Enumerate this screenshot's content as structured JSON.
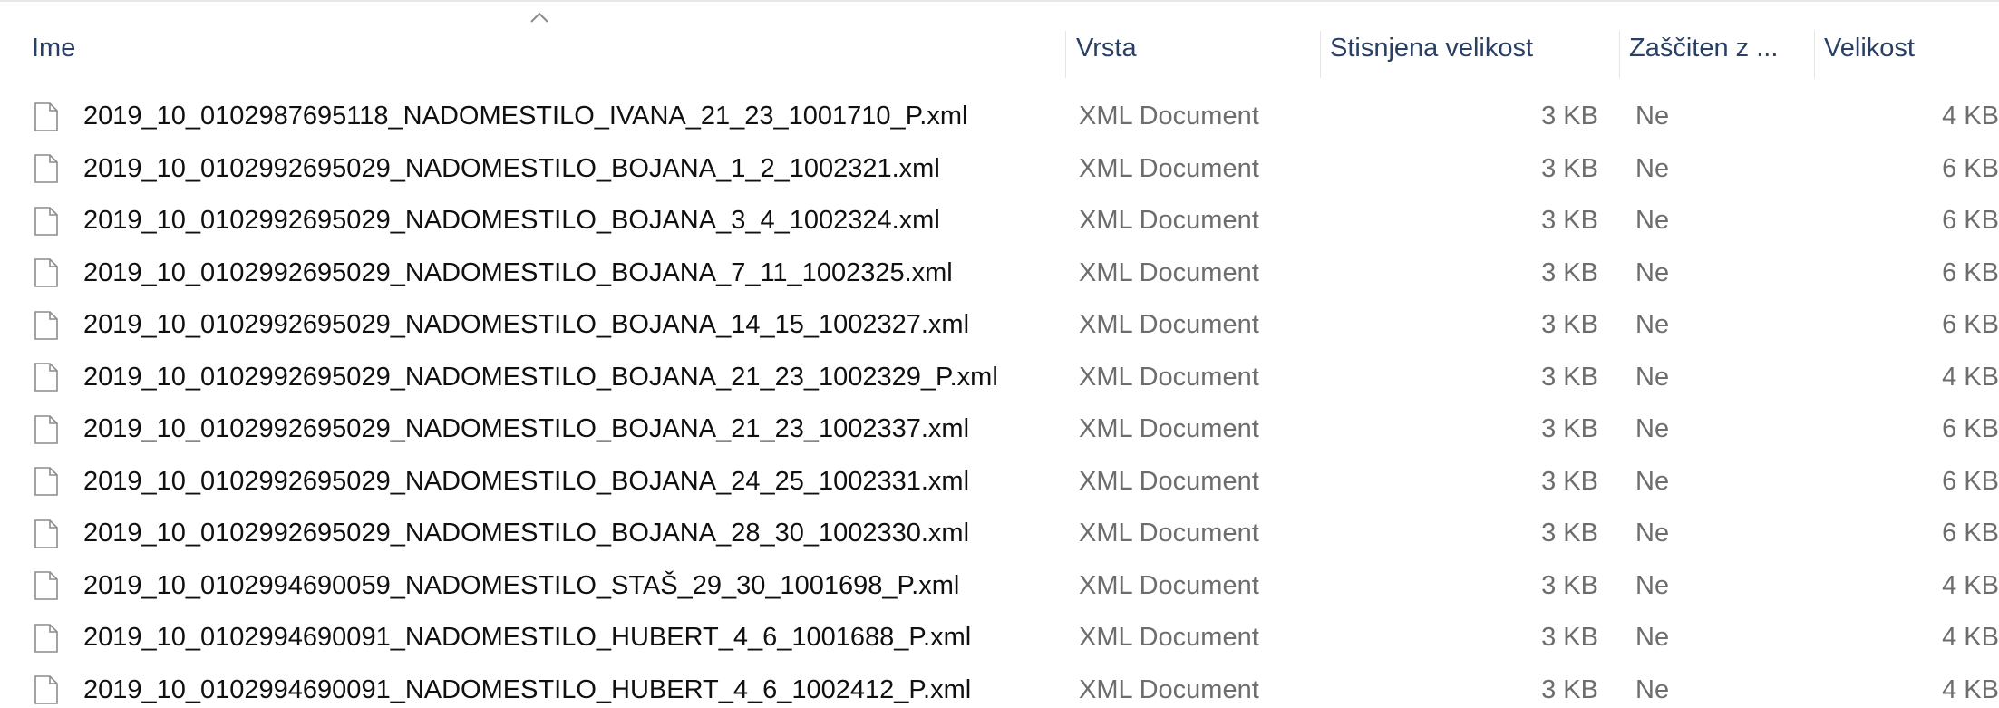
{
  "columns": {
    "name": "Ime",
    "type": "Vrsta",
    "compressed": "Stisnjena velikost",
    "protected": "Zaščiten z ...",
    "size": "Velikost"
  },
  "files": [
    {
      "name": "2019_10_0102987695118_NADOMESTILO_IVANA_21_23_1001710_P.xml",
      "type": "XML Document",
      "compressed": "3 KB",
      "protected": "Ne",
      "size": "4 KB"
    },
    {
      "name": "2019_10_0102992695029_NADOMESTILO_BOJANA_1_2_1002321.xml",
      "type": "XML Document",
      "compressed": "3 KB",
      "protected": "Ne",
      "size": "6 KB"
    },
    {
      "name": "2019_10_0102992695029_NADOMESTILO_BOJANA_3_4_1002324.xml",
      "type": "XML Document",
      "compressed": "3 KB",
      "protected": "Ne",
      "size": "6 KB"
    },
    {
      "name": "2019_10_0102992695029_NADOMESTILO_BOJANA_7_11_1002325.xml",
      "type": "XML Document",
      "compressed": "3 KB",
      "protected": "Ne",
      "size": "6 KB"
    },
    {
      "name": "2019_10_0102992695029_NADOMESTILO_BOJANA_14_15_1002327.xml",
      "type": "XML Document",
      "compressed": "3 KB",
      "protected": "Ne",
      "size": "6 KB"
    },
    {
      "name": "2019_10_0102992695029_NADOMESTILO_BOJANA_21_23_1002329_P.xml",
      "type": "XML Document",
      "compressed": "3 KB",
      "protected": "Ne",
      "size": "4 KB"
    },
    {
      "name": "2019_10_0102992695029_NADOMESTILO_BOJANA_21_23_1002337.xml",
      "type": "XML Document",
      "compressed": "3 KB",
      "protected": "Ne",
      "size": "6 KB"
    },
    {
      "name": "2019_10_0102992695029_NADOMESTILO_BOJANA_24_25_1002331.xml",
      "type": "XML Document",
      "compressed": "3 KB",
      "protected": "Ne",
      "size": "6 KB"
    },
    {
      "name": "2019_10_0102992695029_NADOMESTILO_BOJANA_28_30_1002330.xml",
      "type": "XML Document",
      "compressed": "3 KB",
      "protected": "Ne",
      "size": "6 KB"
    },
    {
      "name": "2019_10_0102994690059_NADOMESTILO_STAŠ_29_30_1001698_P.xml",
      "type": "XML Document",
      "compressed": "3 KB",
      "protected": "Ne",
      "size": "4 KB"
    },
    {
      "name": "2019_10_0102994690091_NADOMESTILO_HUBERT_4_6_1001688_P.xml",
      "type": "XML Document",
      "compressed": "3 KB",
      "protected": "Ne",
      "size": "4 KB"
    },
    {
      "name": "2019_10_0102994690091_NADOMESTILO_HUBERT_4_6_1002412_P.xml",
      "type": "XML Document",
      "compressed": "3 KB",
      "protected": "Ne",
      "size": "4 KB"
    }
  ],
  "icons": {
    "file": "document-icon",
    "sort": "sort-ascending-icon"
  },
  "colors": {
    "header_text": "#2a3f66",
    "secondary_text": "#6d6d6d",
    "separator": "#e5e5e5"
  }
}
